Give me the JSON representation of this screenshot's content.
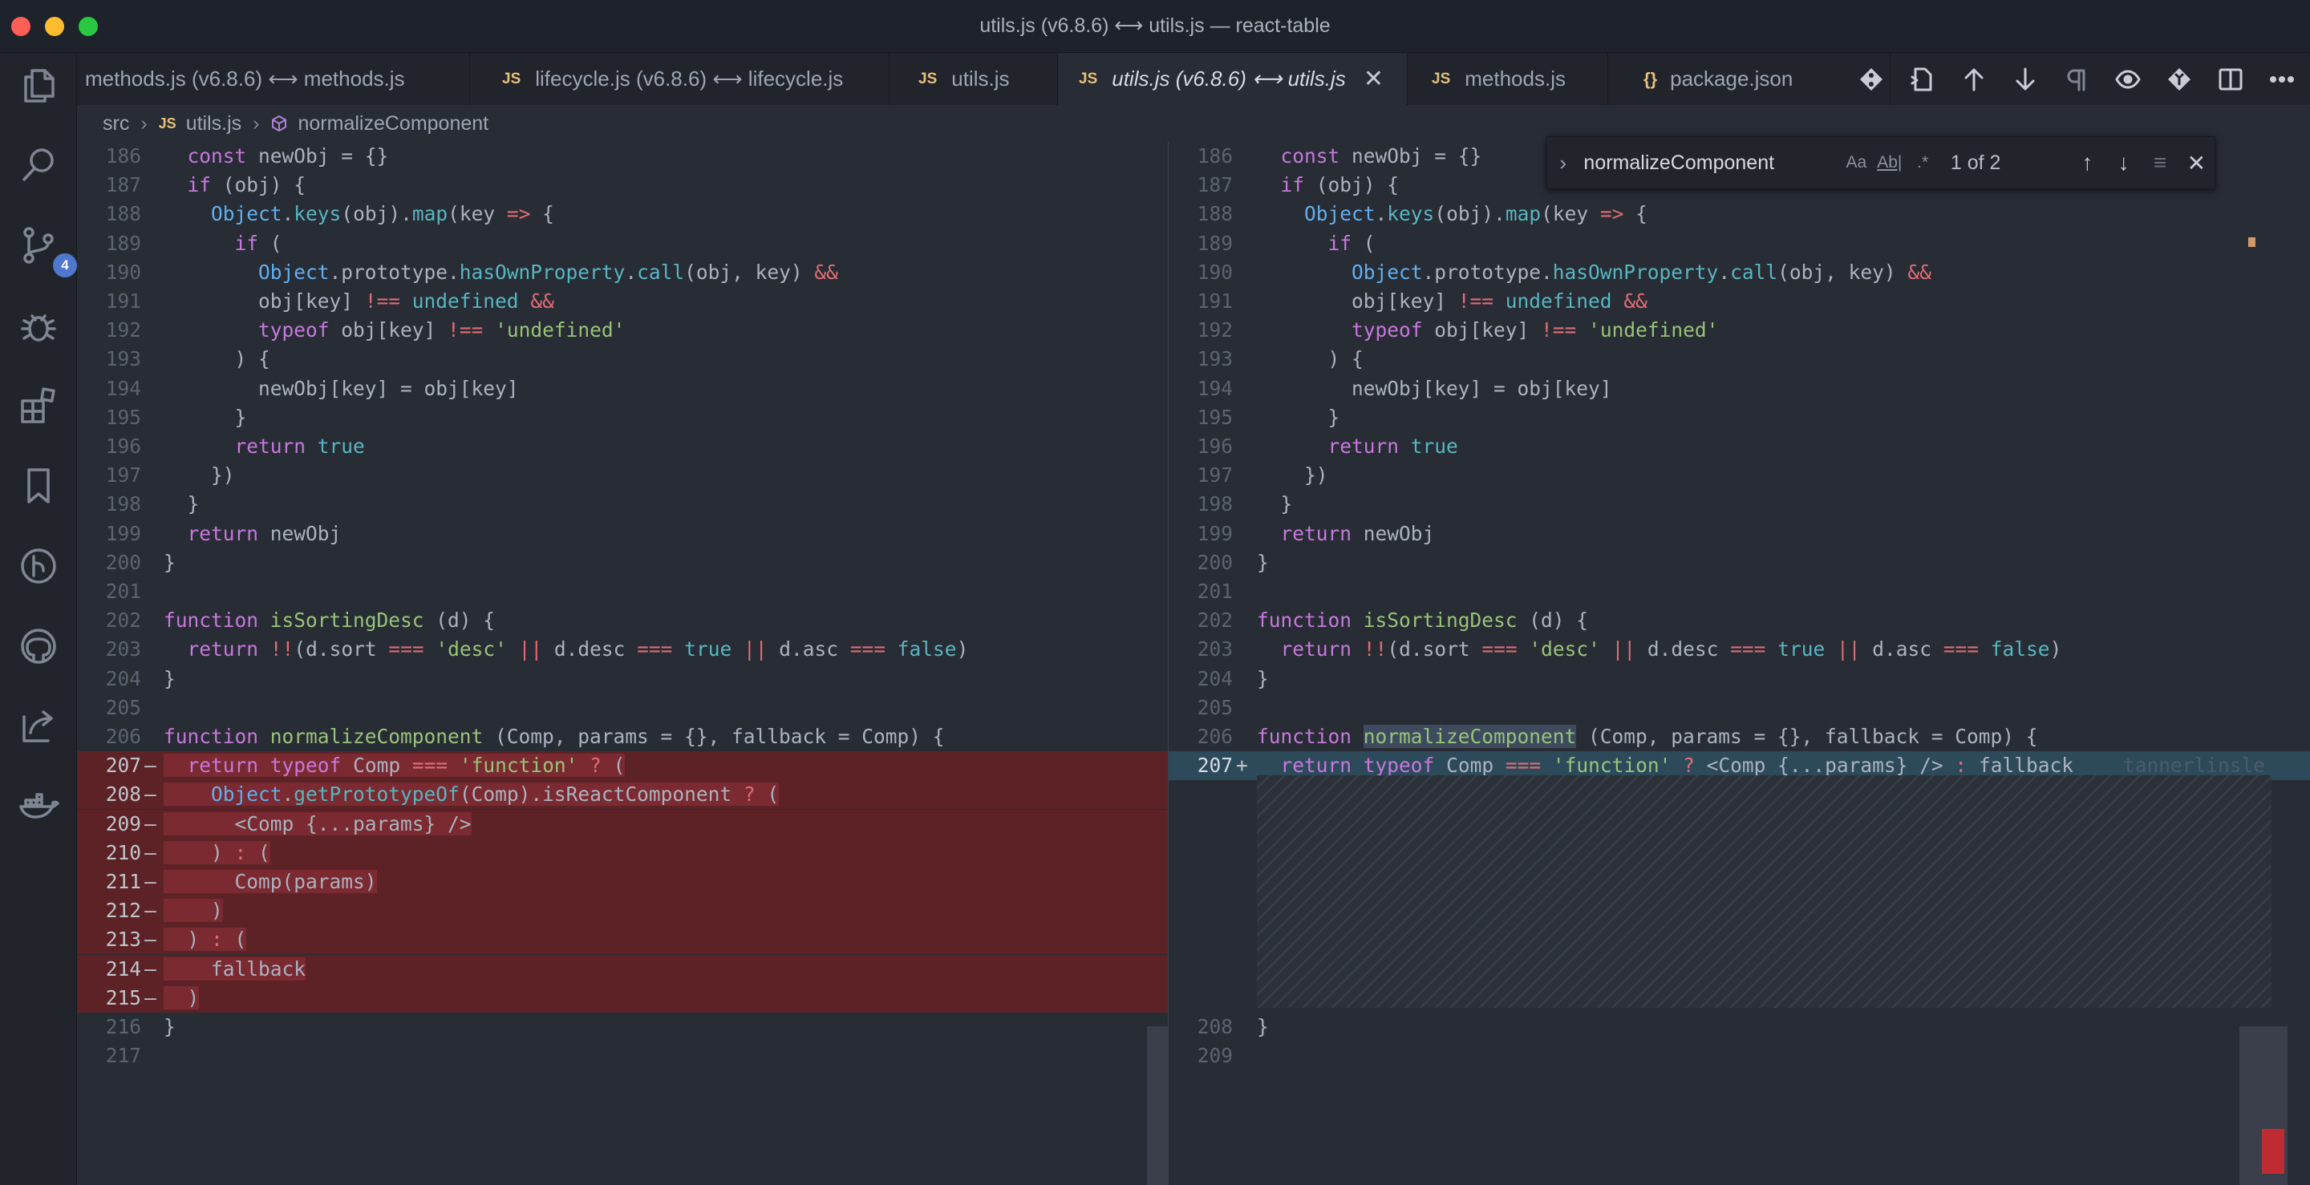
{
  "window": {
    "title": "utils.js (v6.8.6) ⟷ utils.js — react-table"
  },
  "activity_bar": {
    "scm_badge": "4"
  },
  "tabs": [
    {
      "label": "methods.js (v6.8.6) ⟷ methods.js",
      "icon": ""
    },
    {
      "label": "lifecycle.js (v6.8.6) ⟷ lifecycle.js",
      "icon": "JS"
    },
    {
      "label": "utils.js",
      "icon": "JS"
    },
    {
      "label": "utils.js (v6.8.6) ⟷ utils.js",
      "icon": "JS",
      "close": "✕"
    },
    {
      "label": "methods.js",
      "icon": "JS"
    },
    {
      "label": "package.json",
      "icon": "{}"
    }
  ],
  "breadcrumb": {
    "folder": "src",
    "file_icon": "JS",
    "file": "utils.js",
    "symbol": "normalizeComponent"
  },
  "find": {
    "query": "normalizeComponent",
    "match_case": "Aa",
    "whole_word": "Ab|",
    "regex": ".*",
    "count": "1 of 2"
  },
  "left": {
    "lines": [
      {
        "n": "186",
        "m": "",
        "t": "  const newObj = {}"
      },
      {
        "n": "187",
        "m": "",
        "t": "  if (obj) {"
      },
      {
        "n": "188",
        "m": "",
        "t": "    Object.keys(obj).map(key => {"
      },
      {
        "n": "189",
        "m": "",
        "t": "      if ("
      },
      {
        "n": "190",
        "m": "",
        "t": "        Object.prototype.hasOwnProperty.call(obj, key) &&"
      },
      {
        "n": "191",
        "m": "",
        "t": "        obj[key] !== undefined &&"
      },
      {
        "n": "192",
        "m": "",
        "t": "        typeof obj[key] !== 'undefined'"
      },
      {
        "n": "193",
        "m": "",
        "t": "      ) {"
      },
      {
        "n": "194",
        "m": "",
        "t": "        newObj[key] = obj[key]"
      },
      {
        "n": "195",
        "m": "",
        "t": "      }"
      },
      {
        "n": "196",
        "m": "",
        "t": "      return true"
      },
      {
        "n": "197",
        "m": "",
        "t": "    })"
      },
      {
        "n": "198",
        "m": "",
        "t": "  }"
      },
      {
        "n": "199",
        "m": "",
        "t": "  return newObj"
      },
      {
        "n": "200",
        "m": "",
        "t": "}"
      },
      {
        "n": "201",
        "m": "",
        "t": ""
      },
      {
        "n": "202",
        "m": "",
        "t": "function isSortingDesc (d) {"
      },
      {
        "n": "203",
        "m": "",
        "t": "  return !!(d.sort === 'desc' || d.desc === true || d.asc === false)"
      },
      {
        "n": "204",
        "m": "",
        "t": "}"
      },
      {
        "n": "205",
        "m": "",
        "t": ""
      },
      {
        "n": "206",
        "m": "",
        "t": "function normalizeComponent (Comp, params = {}, fallback = Comp) {"
      },
      {
        "n": "207",
        "m": "—",
        "t": "  return typeof Comp === 'function' ? ("
      },
      {
        "n": "208",
        "m": "—",
        "t": "    Object.getPrototypeOf(Comp).isReactComponent ? ("
      },
      {
        "n": "209",
        "m": "—",
        "t": "      <Comp {...params} />"
      },
      {
        "n": "210",
        "m": "—",
        "t": "    ) : ("
      },
      {
        "n": "211",
        "m": "—",
        "t": "      Comp(params)"
      },
      {
        "n": "212",
        "m": "—",
        "t": "    )"
      },
      {
        "n": "213",
        "m": "—",
        "t": "  ) : ("
      },
      {
        "n": "214",
        "m": "—",
        "t": "    fallback"
      },
      {
        "n": "215",
        "m": "—",
        "t": "  )"
      },
      {
        "n": "216",
        "m": "",
        "t": "}"
      },
      {
        "n": "217",
        "m": "",
        "t": ""
      }
    ]
  },
  "right": {
    "lines": [
      {
        "n": "186",
        "t": "  const newObj = {}"
      },
      {
        "n": "187",
        "t": "  if (obj) {"
      },
      {
        "n": "188",
        "t": "    Object.keys(obj).map(key => {"
      },
      {
        "n": "189",
        "t": "      if ("
      },
      {
        "n": "190",
        "t": "        Object.prototype.hasOwnProperty.call(obj, key) &&"
      },
      {
        "n": "191",
        "t": "        obj[key] !== undefined &&"
      },
      {
        "n": "192",
        "t": "        typeof obj[key] !== 'undefined'"
      },
      {
        "n": "193",
        "t": "      ) {"
      },
      {
        "n": "194",
        "t": "        newObj[key] = obj[key]"
      },
      {
        "n": "195",
        "t": "      }"
      },
      {
        "n": "196",
        "t": "      return true"
      },
      {
        "n": "197",
        "t": "    })"
      },
      {
        "n": "198",
        "t": "  }"
      },
      {
        "n": "199",
        "t": "  return newObj"
      },
      {
        "n": "200",
        "t": "}"
      },
      {
        "n": "201",
        "t": ""
      },
      {
        "n": "202",
        "t": "function isSortingDesc (d) {"
      },
      {
        "n": "203",
        "t": "  return !!(d.sort === 'desc' || d.desc === true || d.asc === false)"
      },
      {
        "n": "204",
        "t": "}"
      },
      {
        "n": "205",
        "t": ""
      },
      {
        "n": "206",
        "t": "function normalizeComponent (Comp, params = {}, fallback = Comp) {"
      },
      {
        "n": "207",
        "m": "+",
        "t": "  return typeof Comp === 'function' ? <Comp {...params} /> : fallback"
      },
      {
        "n": "208",
        "t": "}"
      },
      {
        "n": "209",
        "t": ""
      }
    ],
    "blame": "tannerlinsle"
  }
}
